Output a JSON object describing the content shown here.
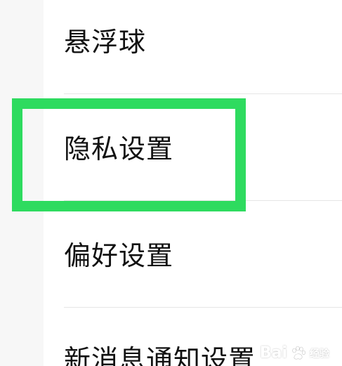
{
  "settings": {
    "items": [
      {
        "label": "悬浮球"
      },
      {
        "label": "隐私设置"
      },
      {
        "label": "偏好设置"
      },
      {
        "label": "新消息通知设置"
      }
    ]
  },
  "highlight": {
    "color": "#2edb5f",
    "target": "隐私设置"
  },
  "watermark": {
    "brand": "Bai",
    "suffix": "经验",
    "icon": "paw-icon"
  }
}
